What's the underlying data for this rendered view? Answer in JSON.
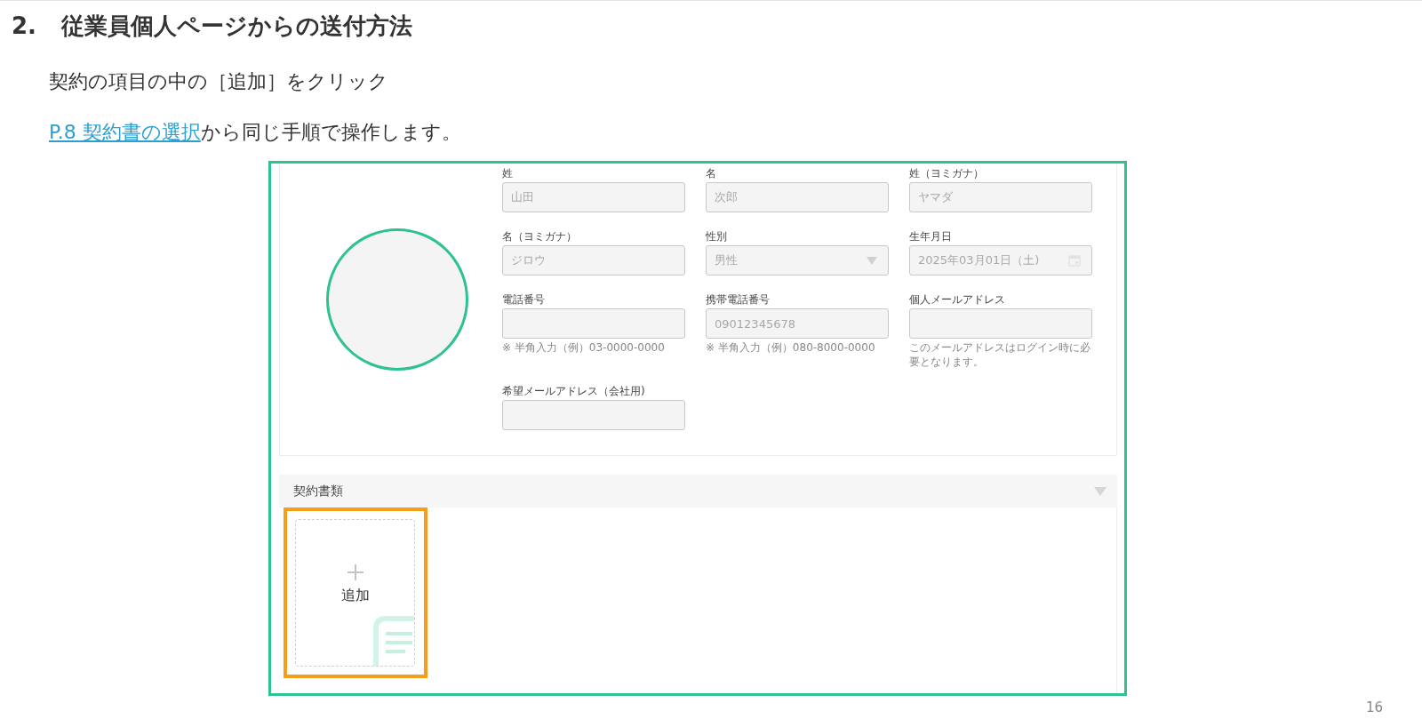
{
  "heading": {
    "number": "2.",
    "title": "従業員個人ページからの送付方法"
  },
  "instructions": [
    {
      "text": "契約の項目の中の［追加］をクリック"
    },
    {
      "link": "P.8 契約書の選択",
      "text": "から同じ手順で操作します。"
    }
  ],
  "screenshot": {
    "fields": [
      {
        "label": "姓",
        "kind": "text",
        "value": "山田"
      },
      {
        "label": "名",
        "kind": "text",
        "value": "次郎"
      },
      {
        "label": "姓（ヨミガナ）",
        "kind": "text",
        "value": "ヤマダ"
      },
      {
        "label": "名（ヨミガナ）",
        "kind": "text",
        "value": "ジロウ"
      },
      {
        "label": "性別",
        "kind": "select",
        "value": "男性"
      },
      {
        "label": "生年月日",
        "kind": "date",
        "value": "2025年03月01日（土)"
      },
      {
        "label": "電話番号",
        "kind": "text",
        "hint": "※ 半角入力（例）03-0000-0000"
      },
      {
        "label": "携帯電話番号",
        "kind": "text",
        "value": "09012345678",
        "hint": "※ 半角入力（例）080-8000-0000"
      },
      {
        "label": "個人メールアドレス",
        "kind": "text",
        "hint": "このメールアドレスはログイン時に必要となります。"
      },
      {
        "label": "希望メールアドレス（会社用)",
        "kind": "text"
      }
    ],
    "section": {
      "title": "契約書類"
    },
    "add_card": {
      "label": "追加"
    }
  },
  "page_number": "16"
}
